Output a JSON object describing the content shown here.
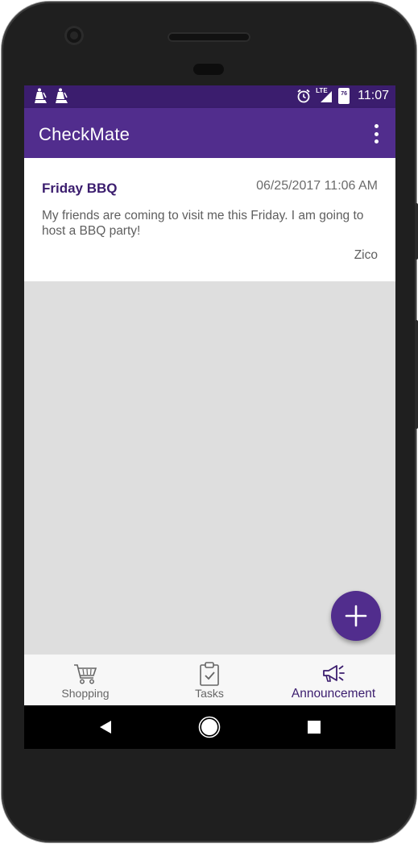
{
  "status_bar": {
    "time": "11:07",
    "network": "LTE",
    "battery": "76",
    "notification_icons": [
      "chess-bishop-notification-icon",
      "chess-bishop-notification-icon"
    ]
  },
  "app_bar": {
    "title": "CheckMate",
    "overflow_icon": "more-vert-icon"
  },
  "announcements": [
    {
      "title": "Friday BBQ",
      "datetime": "06/25/2017 11:06 AM",
      "body": "My friends are coming to visit me this Friday. I am going to host a BBQ party!",
      "author": "Zico"
    }
  ],
  "fab": {
    "icon": "plus-icon"
  },
  "bottom_nav": {
    "items": [
      {
        "label": "Shopping",
        "icon": "shopping-cart-icon",
        "active": false
      },
      {
        "label": "Tasks",
        "icon": "clipboard-check-icon",
        "active": false
      },
      {
        "label": "Announcement",
        "icon": "megaphone-icon",
        "active": true
      }
    ]
  },
  "system_nav": {
    "back_icon": "back-triangle-icon",
    "home_icon": "home-circle-icon",
    "recents_icon": "recents-square-icon"
  },
  "colors": {
    "primary": "#512d8d",
    "primary_dark": "#3b1d6e",
    "background": "#dedede"
  }
}
